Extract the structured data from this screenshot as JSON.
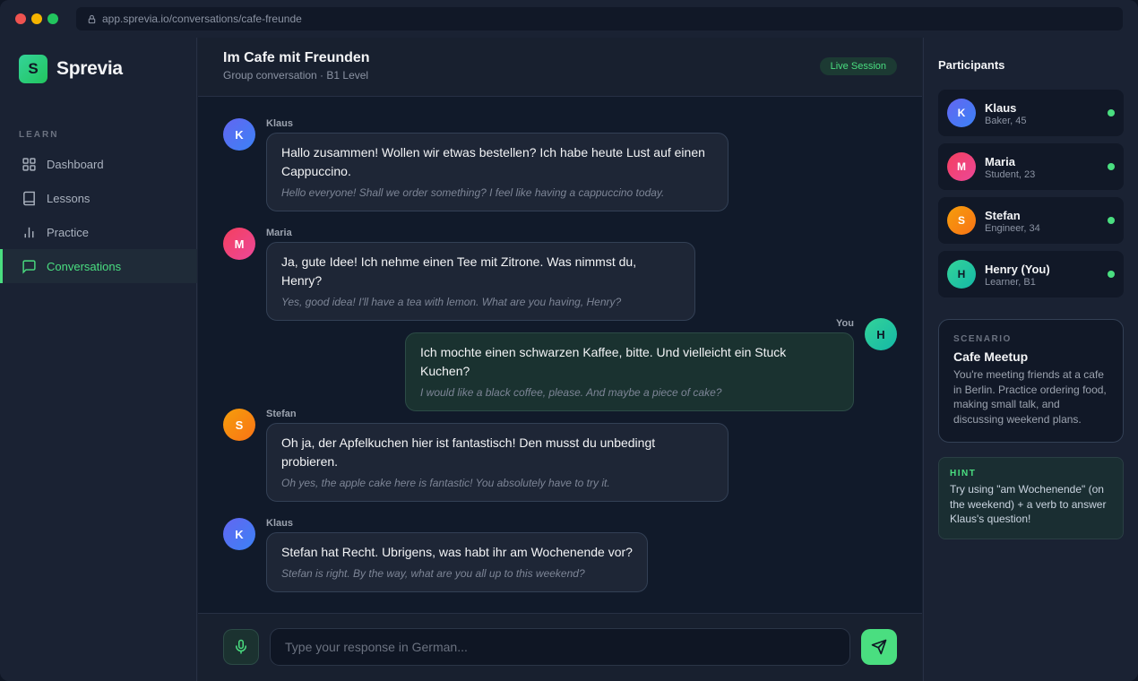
{
  "browser": {
    "url": "app.sprevia.io/conversations/cafe-freunde"
  },
  "app": {
    "logo_letter": "S",
    "name": "Sprevia"
  },
  "sidebar": {
    "section": "LEARN",
    "items": [
      {
        "label": "Dashboard",
        "icon": "grid-icon",
        "active": false
      },
      {
        "label": "Lessons",
        "icon": "book-icon",
        "active": false
      },
      {
        "label": "Practice",
        "icon": "bar-chart-icon",
        "active": false
      },
      {
        "label": "Conversations",
        "icon": "chat-icon",
        "active": true
      }
    ]
  },
  "chat": {
    "title": "Im Cafe mit Freunden",
    "subtitle": "Group conversation · B1 Level",
    "badge": "Live Session",
    "messages": [
      {
        "sender": "Klaus",
        "initial": "K",
        "text": "Hallo zusammen! Wollen wir etwas bestellen? Ich habe heute Lust auf einen Cappuccino.",
        "translation": "Hello everyone! Shall we order something? I feel like having a cappuccino today."
      },
      {
        "sender": "Maria",
        "initial": "M",
        "text": "Ja, gute Idee! Ich nehme einen Tee mit Zitrone. Was nimmst du, Henry?",
        "translation": "Yes, good idea! I'll have a tea with lemon. What are you having, Henry?"
      },
      {
        "sender": "You",
        "initial": "H",
        "text": "Ich mochte einen schwarzen Kaffee, bitte. Und vielleicht ein Stuck Kuchen?",
        "translation": "I would like a black coffee, please. And maybe a piece of cake?"
      },
      {
        "sender": "Stefan",
        "initial": "S",
        "text": "Oh ja, der Apfelkuchen hier ist fantastisch! Den musst du unbedingt probieren.",
        "translation": "Oh yes, the apple cake here is fantastic! You absolutely have to try it."
      },
      {
        "sender": "Klaus",
        "initial": "K",
        "text": "Stefan hat Recht. Ubrigens, was habt ihr am Wochenende vor?",
        "translation": "Stefan is right. By the way, what are you all up to this weekend?"
      }
    ],
    "input_placeholder": "Type your response in German..."
  },
  "participants": {
    "title": "Participants",
    "list": [
      {
        "initial": "K",
        "name": "Klaus",
        "role": "Baker, 45",
        "online": true
      },
      {
        "initial": "M",
        "name": "Maria",
        "role": "Student, 23",
        "online": true
      },
      {
        "initial": "S",
        "name": "Stefan",
        "role": "Engineer, 34",
        "online": true
      },
      {
        "initial": "H",
        "name": "Henry (You)",
        "role": "Learner, B1",
        "online": true
      }
    ]
  },
  "scenario": {
    "label": "SCENARIO",
    "title": "Cafe Meetup",
    "description": "You're meeting friends at a cafe in Berlin. Practice ordering food, making small talk, and discussing weekend plans."
  },
  "hint": {
    "label": "HINT",
    "text": "Try using \"am Wochenende\" (on the weekend) + a verb to answer Klaus's question!"
  },
  "colors": {
    "accent": "#4ade80",
    "background": "#111a2a",
    "panel": "#1a2233"
  }
}
